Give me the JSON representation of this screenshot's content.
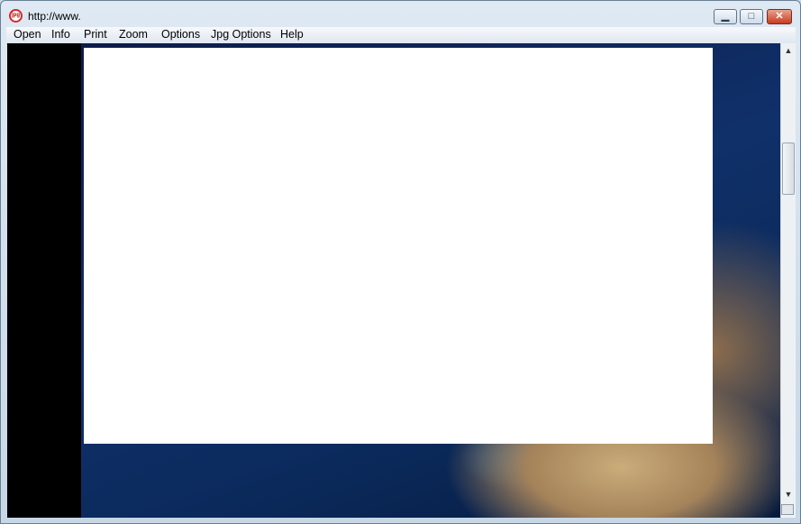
{
  "window": {
    "title": "http://www.",
    "controls": {
      "minimize": "▁",
      "maximize": "□",
      "close": "✕"
    },
    "app_icon": "no-jpg-icon"
  },
  "menu": [
    "Open",
    "Info",
    "Print",
    "Zoom",
    "Options",
    "Jpg Options",
    "Help"
  ],
  "scrollbar": {
    "up_arrow": "▲",
    "down_arrow": "▼"
  },
  "colors": {
    "titlebar": "#c7d7e6",
    "close_button": "#c73b22",
    "viewport_background": "#000000",
    "ocean": "#0b2a5c"
  }
}
